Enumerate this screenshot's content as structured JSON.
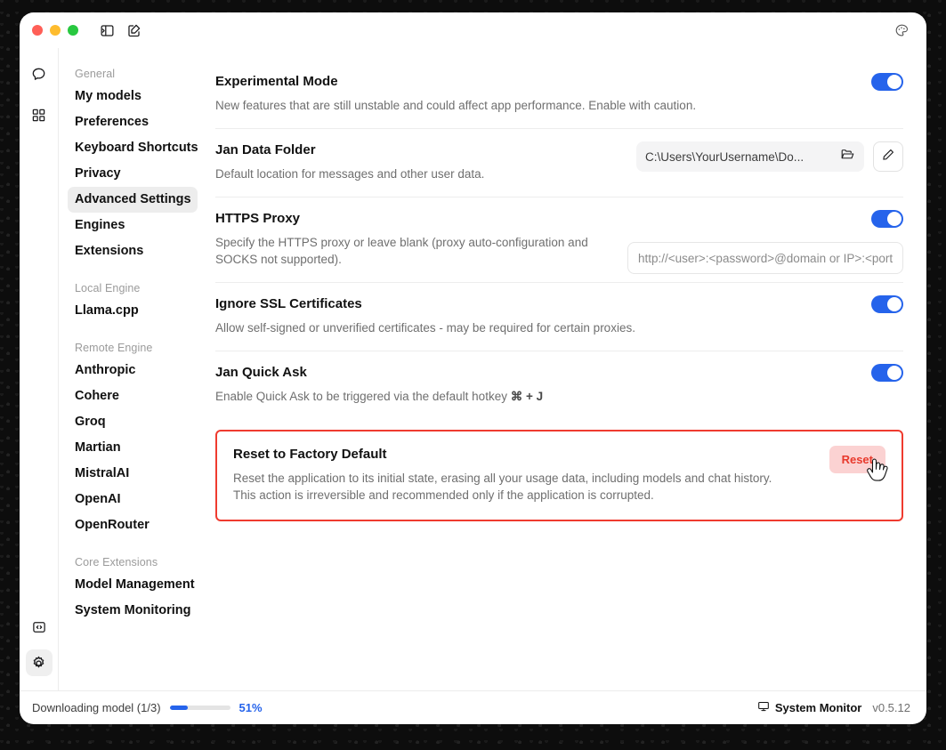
{
  "titlebar": {
    "lights": [
      "close",
      "minimize",
      "maximize"
    ],
    "collapse_icon": "panel-collapse-icon",
    "compose_icon": "compose-icon",
    "theme_icon": "palette-icon"
  },
  "rail": {
    "items": [
      {
        "name": "chat-icon",
        "active": false
      },
      {
        "name": "grid-icon",
        "active": false
      }
    ],
    "bottom": [
      {
        "name": "code-icon",
        "active": false
      },
      {
        "name": "gear-icon",
        "active": true
      }
    ]
  },
  "sidebar": {
    "groups": [
      {
        "label": "General",
        "items": [
          {
            "label": "My models",
            "active": false
          },
          {
            "label": "Preferences",
            "active": false
          },
          {
            "label": "Keyboard Shortcuts",
            "active": false
          },
          {
            "label": "Privacy",
            "active": false
          },
          {
            "label": "Advanced Settings",
            "active": true
          },
          {
            "label": "Engines",
            "active": false
          },
          {
            "label": "Extensions",
            "active": false
          }
        ]
      },
      {
        "label": "Local Engine",
        "items": [
          {
            "label": "Llama.cpp",
            "active": false
          }
        ]
      },
      {
        "label": "Remote Engine",
        "items": [
          {
            "label": "Anthropic",
            "active": false
          },
          {
            "label": "Cohere",
            "active": false
          },
          {
            "label": "Groq",
            "active": false
          },
          {
            "label": "Martian",
            "active": false
          },
          {
            "label": "MistralAI",
            "active": false
          },
          {
            "label": "OpenAI",
            "active": false
          },
          {
            "label": "OpenRouter",
            "active": false
          }
        ]
      },
      {
        "label": "Core Extensions",
        "items": [
          {
            "label": "Model Management",
            "active": false
          },
          {
            "label": "System Monitoring",
            "active": false
          }
        ]
      }
    ]
  },
  "settings": {
    "experimental": {
      "title": "Experimental Mode",
      "desc": "New features that are still unstable and could affect app performance. Enable with caution.",
      "toggle_on": true
    },
    "data_folder": {
      "title": "Jan Data Folder",
      "desc": "Default location for messages and other user data.",
      "path": "C:\\Users\\YourUsername\\Do...",
      "folder_icon": "folder-open-icon",
      "edit_icon": "pencil-icon"
    },
    "https_proxy": {
      "title": "HTTPS Proxy",
      "desc": "Specify the HTTPS proxy or leave blank (proxy auto-configuration and SOCKS not supported).",
      "placeholder": "http://<user>:<password>@domain or IP>:<port>",
      "value": "",
      "toggle_on": true
    },
    "ignore_ssl": {
      "title": "Ignore SSL Certificates",
      "desc": "Allow self-signed or unverified certificates - may be required for certain proxies.",
      "toggle_on": true
    },
    "quick_ask": {
      "title": "Jan Quick Ask",
      "desc_prefix": "Enable Quick Ask to be triggered via the default hotkey ",
      "hotkey": "⌘ + J",
      "toggle_on": true
    },
    "reset": {
      "title": "Reset to Factory Default",
      "desc": "Reset the application to its initial state, erasing all your usage data, including models and chat history. This action is irreversible and recommended only if the application is corrupted.",
      "button_label": "Reset",
      "highlight_color": "#ef3b2f",
      "button_bg": "#fbd2d2",
      "button_fg": "#e8392c"
    }
  },
  "statusbar": {
    "download_text": "Downloading model (1/3)",
    "progress_percent": "51%",
    "progress_value": 30,
    "system_monitor_label": "System Monitor",
    "monitor_icon": "monitor-icon",
    "version": "v0.5.12"
  },
  "colors": {
    "accent": "#2563eb",
    "danger": "#ef3b2f"
  }
}
